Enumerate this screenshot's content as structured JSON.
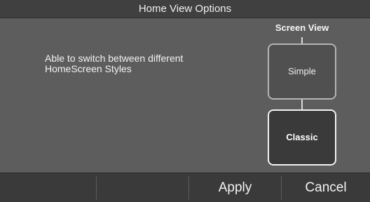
{
  "header": {
    "title": "Home View Options"
  },
  "body": {
    "description": "Able to switch between different HomeScreen Styles"
  },
  "screen_view": {
    "label": "Screen View",
    "options": [
      {
        "label": "Simple",
        "selected": false
      },
      {
        "label": "Classic",
        "selected": true
      }
    ]
  },
  "footer": {
    "apply_label": "Apply",
    "cancel_label": "Cancel"
  },
  "colors": {
    "background": "#5d5d5d",
    "bar": "#3a3a3a",
    "text": "#f4f4f4",
    "selected_border": "#f2f2f2"
  }
}
